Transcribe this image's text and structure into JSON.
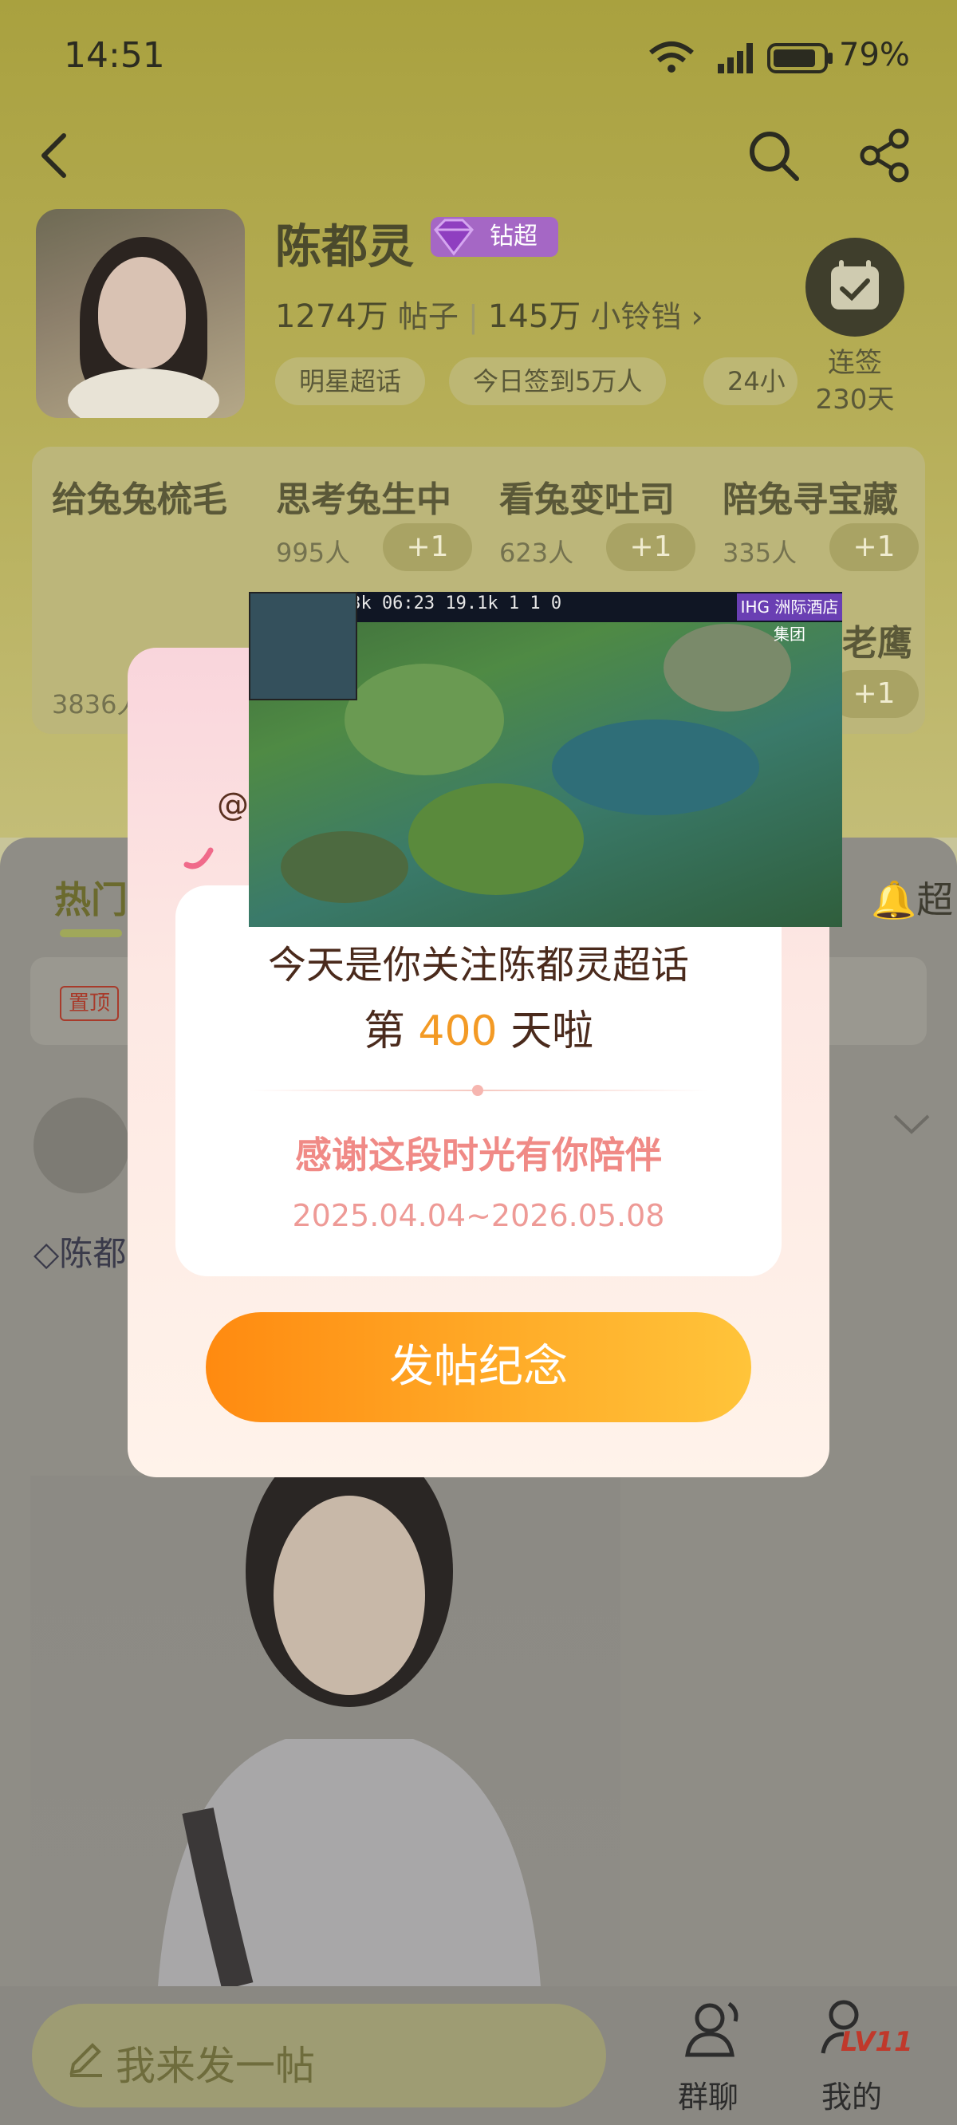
{
  "status_bar": {
    "time": "14:51",
    "battery": "79%"
  },
  "header": {
    "title": "陈都灵",
    "badge": "钻超",
    "posts_count": "1274万",
    "posts_label": "帖子",
    "members_count": "145万",
    "members_label": "小铃铛",
    "chips": [
      "明星超话",
      "今日签到5万人",
      "24小"
    ],
    "checkin_label_1": "连签",
    "checkin_label_2": "230天"
  },
  "topics": [
    {
      "title": "给兔兔梳毛",
      "count": "3836人",
      "plus": "+1"
    },
    {
      "title": "思考兔生中",
      "count": "995人",
      "plus": "+1"
    },
    {
      "title": "看兔变吐司",
      "count": "623人",
      "plus": "+1"
    },
    {
      "title": "陪兔寻宝藏",
      "count": "335人",
      "plus": "+1"
    }
  ],
  "topic_extra": {
    "title": "老鹰",
    "plus": "+1"
  },
  "feed": {
    "hot_tab": "热门",
    "super_tab": "超",
    "pinned_badge": "置顶",
    "post_user": "陈都"
  },
  "bottom_bar": {
    "compose_placeholder": "我来发一帖",
    "group_chat": "群聊",
    "me": "我的",
    "level": "LV11"
  },
  "modal": {
    "at_symbol": "@",
    "line1": "今天是你关注陈都灵超话",
    "line2_prefix": "第",
    "days": "400",
    "line2_suffix": "天啦",
    "thanks": "感谢这段时光有你陪伴",
    "date_range": "2025.04.04~2026.05.08",
    "cta_label": "发帖纪念"
  },
  "game_overlay": {
    "hud": "1    0  1  18.3k  06:23  19.1k  1  1  0",
    "sponsor": "IHG 洲际酒店集团"
  },
  "colors": {
    "accent_orange": "#f39a25",
    "cta_orange": "#ff8a10",
    "badge_purple": "#a567c5",
    "thanks_pink": "#f08a86"
  }
}
